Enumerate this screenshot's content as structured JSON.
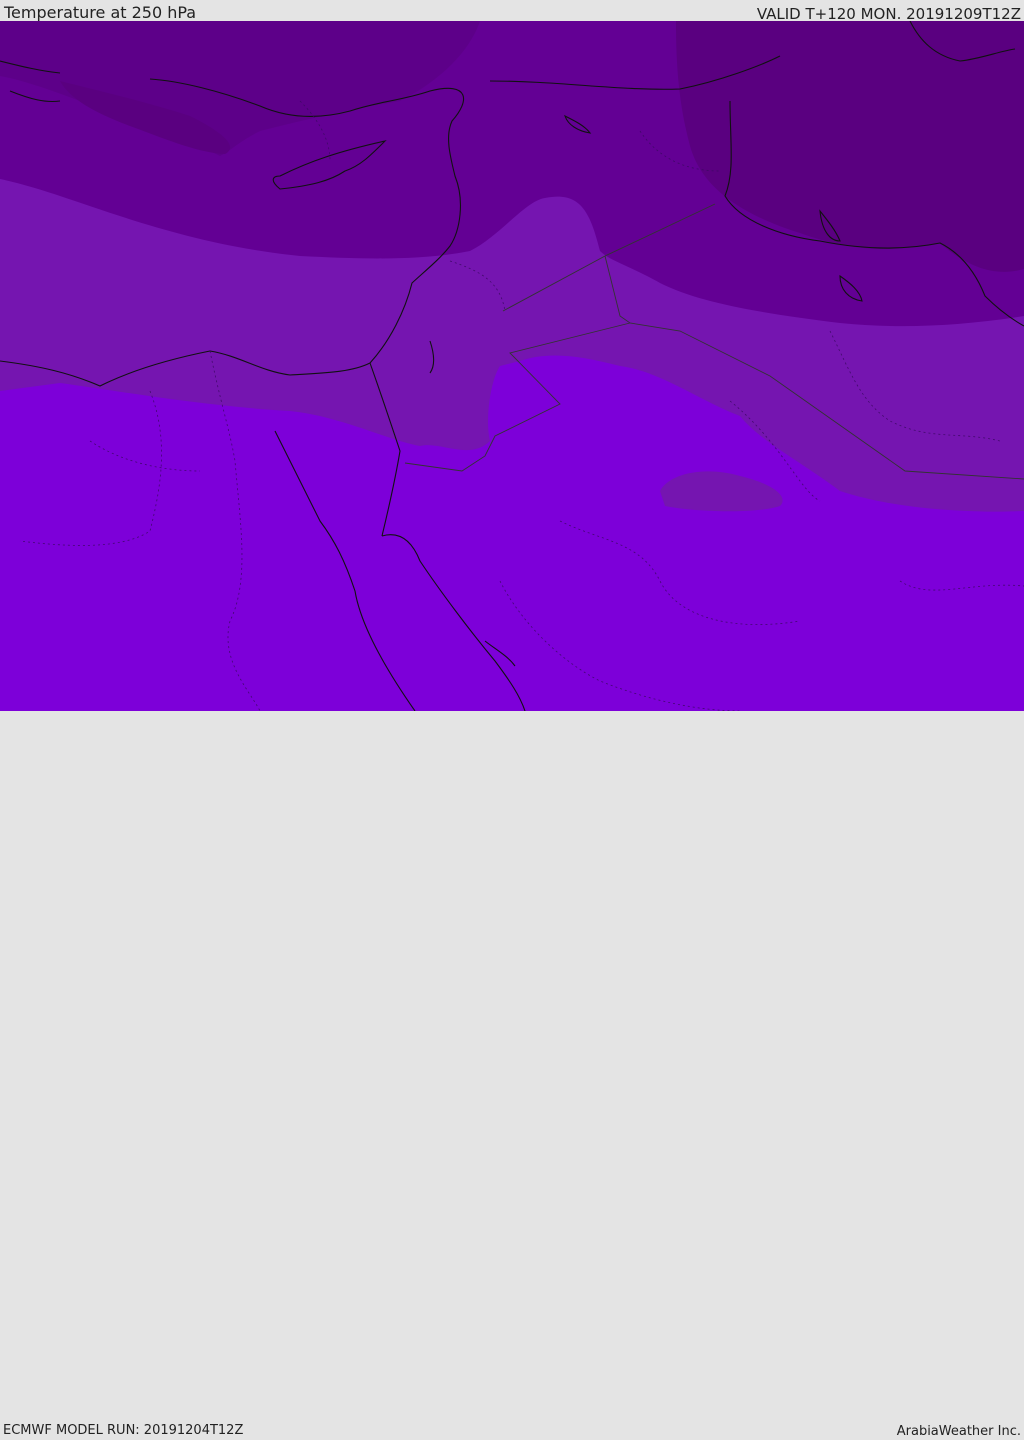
{
  "header": {
    "title": "Temperature at 250 hPa",
    "valid": "VALID T+120 MON. 20191209T12Z"
  },
  "footer": {
    "model_run": "ECMWF MODEL RUN: 20191204T12Z",
    "credit": "ArabiaWeather Inc."
  },
  "colors": {
    "coldest": "#5a0080",
    "cold": "#630094",
    "cool": "#7515b0",
    "warm": "#7d00d9",
    "coastline": "#111111",
    "border": "#333333"
  }
}
